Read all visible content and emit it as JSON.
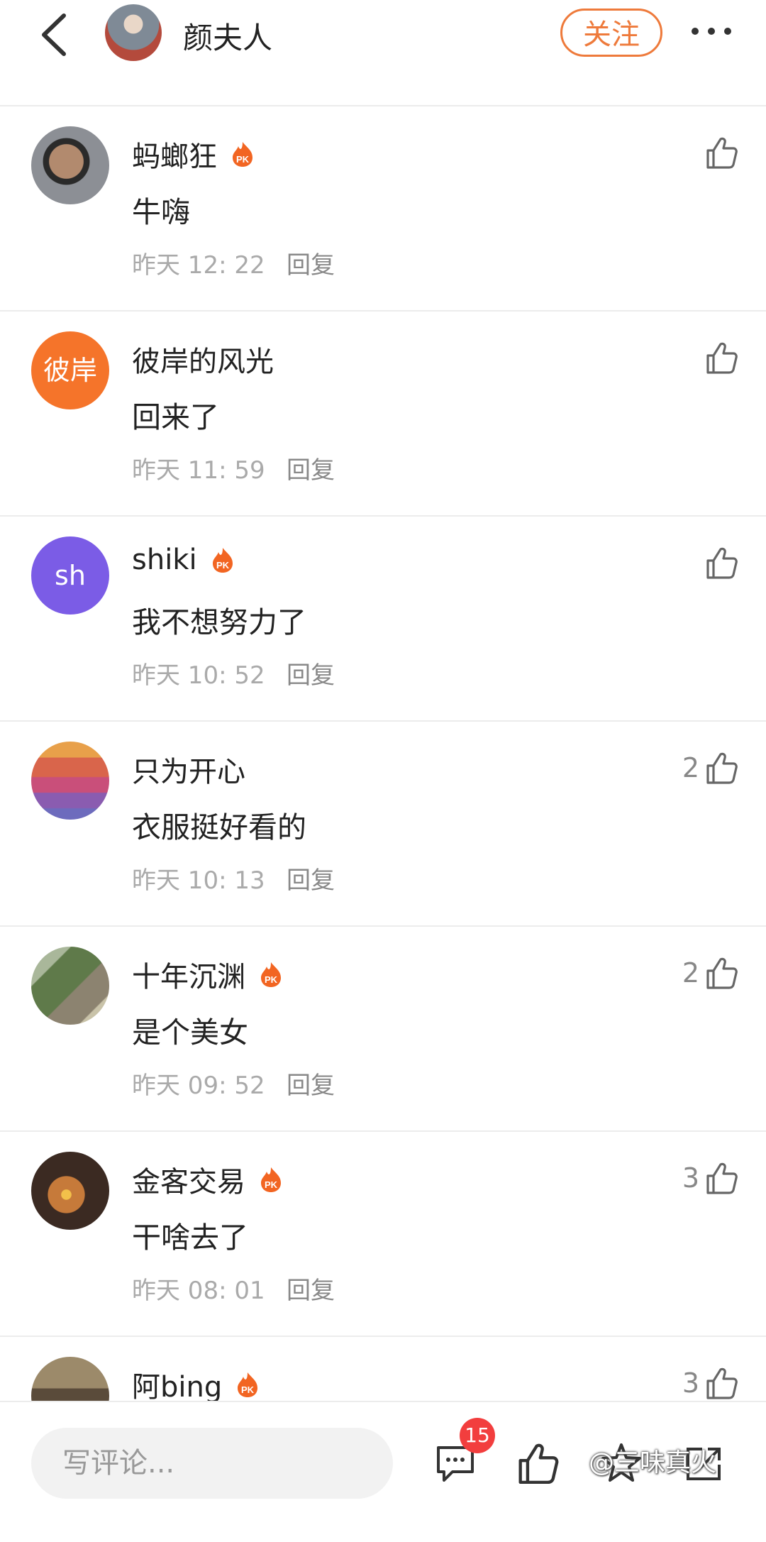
{
  "header": {
    "title": "颜夫人",
    "follow_label": "关注"
  },
  "comments": [
    {
      "name": "蚂螂狂",
      "pk": true,
      "text": "牛嗨",
      "time": "昨天 12: 22",
      "reply": "回复",
      "likes": ""
    },
    {
      "name": "彼岸的风光",
      "pk": false,
      "avatar_text": "彼岸",
      "text": "回来了",
      "time": "昨天 11: 59",
      "reply": "回复",
      "likes": ""
    },
    {
      "name": "shiki",
      "pk": true,
      "avatar_text": "sh",
      "text": "我不想努力了",
      "time": "昨天 10: 52",
      "reply": "回复",
      "likes": ""
    },
    {
      "name": "只为开心",
      "pk": false,
      "text": "衣服挺好看的",
      "time": "昨天 10: 13",
      "reply": "回复",
      "likes": "2"
    },
    {
      "name": "十年沉渊",
      "pk": true,
      "text": "是个美女",
      "time": "昨天 09: 52",
      "reply": "回复",
      "likes": "2"
    },
    {
      "name": "金客交易",
      "pk": true,
      "text": "干啥去了",
      "time": "昨天 08: 01",
      "reply": "回复",
      "likes": "3"
    },
    {
      "name": "阿bing",
      "pk": true,
      "text": "",
      "time": "",
      "reply": "",
      "likes": "3"
    }
  ],
  "bottom": {
    "input_placeholder": "写评论...",
    "comment_count": "15",
    "watermark": "@三味真火"
  },
  "colors": {
    "accent": "#ee7a3b",
    "badge": "#f23e3e",
    "avatar_orange": "#f5742a",
    "avatar_purple": "#7b5ce6"
  }
}
